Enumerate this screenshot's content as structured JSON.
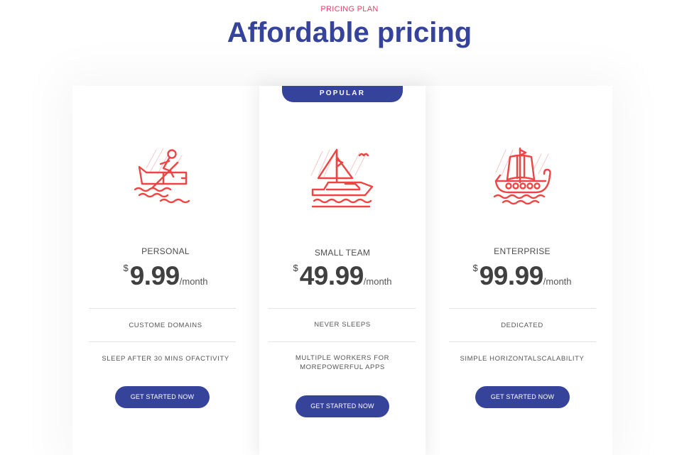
{
  "header": {
    "eyebrow": "PRICING PLAN",
    "title": "Affordable pricing"
  },
  "colors": {
    "accent": "#36439a",
    "eyebrow": "#e4406b",
    "icon": "#ef4444"
  },
  "badge": "POPULAR",
  "plans": [
    {
      "name": "PERSONAL",
      "currency": "$",
      "amount": "9.99",
      "period": "/month",
      "features": [
        "CUSTOME DOMAINS",
        "SLEEP AFTER 30 MINS OFACTIVITY"
      ],
      "cta": "GET STARTED NOW",
      "icon": "rowboat-icon"
    },
    {
      "name": "SMALL TEAM",
      "currency": "$",
      "amount": "49.99",
      "period": "/month",
      "features": [
        "NEVER SLEEPS",
        "MULTIPLE WORKERS FOR MOREPOWERFUL APPS"
      ],
      "cta": "GET STARTED NOW",
      "icon": "sailboat-yacht-icon"
    },
    {
      "name": "ENTERPRISE",
      "currency": "$",
      "amount": "99.99",
      "period": "/month",
      "features": [
        "DEDICATED",
        "SIMPLE HORIZONTALSCALABILITY"
      ],
      "cta": "GET STARTED NOW",
      "icon": "viking-ship-icon"
    }
  ]
}
